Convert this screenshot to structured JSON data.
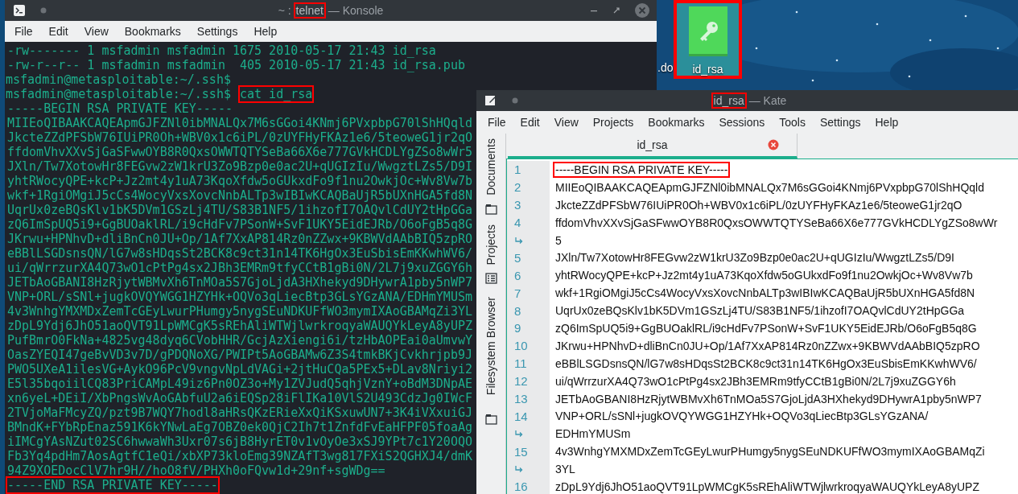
{
  "desktop": {
    "icons": [
      {
        "kind": "label-only",
        "label": ".do"
      },
      {
        "kind": "key-file",
        "label": "id_rsa",
        "selected": true,
        "highlighted": true
      }
    ]
  },
  "konsole": {
    "title": [
      {
        "text": "~ :",
        "highlighted": false
      },
      {
        "text": "telnet",
        "highlighted": true
      },
      {
        "text": "— Konsole",
        "highlighted": false
      }
    ],
    "menu": [
      "File",
      "Edit",
      "View",
      "Bookmarks",
      "Settings",
      "Help"
    ],
    "lines": [
      {
        "text": "-rw------- 1 msfadmin msfadmin 1675 2010-05-17 21:43 id_rsa",
        "highlighted": false
      },
      {
        "text": "-rw-r--r-- 1 msfadmin msfadmin  405 2010-05-17 21:43 id_rsa.pub",
        "highlighted": false
      },
      {
        "prompt": "msfadmin@metasploitable:~/.ssh$"
      },
      {
        "prompt": "msfadmin@metasploitable:~/.ssh$",
        "text": "cat id_rsa",
        "highlighted": true
      },
      {
        "text": "-----BEGIN RSA PRIVATE KEY-----",
        "highlighted": false
      },
      {
        "text": "MIIEoQIBAAKCAQEApmGJFZNl0ibMNALQx7M6sGGoi4KNmj6PVxpbpG70lShHQqld",
        "highlighted": false
      },
      {
        "text": "JkcteZZdPFSbW76IUiPR0Oh+WBV0x1c6iPL/0zUYFHyFKAz1e6/5teoweG1jr2qO",
        "highlighted": false
      },
      {
        "text": "ffdomVhvXXvSjGaSFwwOYB8R0QxsOWWTQTYSeBa66X6e777GVkHCDLYgZSo8wWr5",
        "highlighted": false
      },
      {
        "text": "JXln/Tw7XotowHr8FEGvw2zW1krU3Zo9Bzp0e0ac2U+qUGIzIu/WwgztLZs5/D9I",
        "highlighted": false
      },
      {
        "text": "yhtRWocyQPE+kcP+Jz2mt4y1uA73KqoXfdw5oGUkxdFo9f1nu2OwkjOc+Wv8Vw7b",
        "highlighted": false
      },
      {
        "text": "wkf+1RgiOMgiJ5cCs4WocyVxsXovcNnbALTp3wIBIwKCAQBaUjR5bUXnHGA5fd8N",
        "highlighted": false
      },
      {
        "text": "UqrUx0zeBQsKlv1bK5DVm1GSzLj4TU/S83B1NF5/1ihzofI7OAQvlCdUY2tHpGGa",
        "highlighted": false
      },
      {
        "text": "zQ6ImSpUQ5i9+GgBUOaklRL/i9cHdFv7PSonW+SvF1UKY5EidEJRb/O6oFgB5q8G",
        "highlighted": false
      },
      {
        "text": "JKrwu+HPNhvD+dliBnCn0JU+Op/1Af7XxAP814Rz0nZZwx+9KBWVdAAbBIQ5zpRO",
        "highlighted": false
      },
      {
        "text": "eBBlLSGDsnsQN/lG7w8sHDqsSt2BCK8c9ct31n14TK6HgOx3EuSbisEmKKwhWV6/",
        "highlighted": false
      },
      {
        "text": "ui/qWrrzurXA4Q73wO1cPtPg4sx2JBh3EMRm9tfyCCtB1gBi0N/2L7j9xuZGGY6h",
        "highlighted": false
      },
      {
        "text": "JETbAoGBANI8HzRjytWBMvXh6TnMOa5S7GjoLjdA3HXhekyd9DHywrA1pby5nWP7",
        "highlighted": false
      },
      {
        "text": "VNP+ORL/sSNl+jugkOVQYWGG1HZYHk+OQVo3qLiecBtp3GLsYGzANA/EDHmYMUSm",
        "highlighted": false
      },
      {
        "text": "4v3WnhgYMXMDxZemTcGEyLwurPHumgy5nygSEuNDKUFfWO3mymIXAoGBAMqZi3YL",
        "highlighted": false
      },
      {
        "text": "zDpL9Ydj6JhO51aoQVT91LpWMCgK5sREhAliWTWjlwrkroqyaWAUQYkLeyA8yUPZ",
        "highlighted": false
      },
      {
        "text": "PufBmrO0FkNa+4825vg48dyq6CVobHHR/GcjAzXiengi6i/tzHbAOPEai0aUmvwY",
        "highlighted": false
      },
      {
        "text": "OasZYEQI47geBvVD3v7D/gPDQNoXG/PWIPt5AoGBAMw6Z3S4tmkBKjCvkhrjpb9J",
        "highlighted": false
      },
      {
        "text": "PWO5UXeA1ilesVG+AykO96PcV9vngvNpLdVAGi+2jtHuCQa5PEx5+DLav8Nriyi2",
        "highlighted": false
      },
      {
        "text": "E5l35bqoiilCQ83PriCAMpL49iz6Pn0OZ3o+My1ZVJudQ5qhjVznY+oBdM3DNpAE",
        "highlighted": false
      },
      {
        "text": "xn6yeL+DEiI/XbPngsWvAoGAbfuU2a6iEQSp28iFlIKa10VlS2U493CdzJg0IWcF",
        "highlighted": false
      },
      {
        "text": "2TVjoMaFMcyZQ/pzt9B7WQY7hodl8aHRsQKzERieXxQiKSxuwUN7+3K4iVXxuiGJ",
        "highlighted": false
      },
      {
        "text": "BMndK+FYbRpEnaz591K6kYNwLaEg7OBZ0ek0QjC2Ih7t1ZnfdFvEaHFPF05foaAg",
        "highlighted": false
      },
      {
        "text": "iIMCgYAsNZut02SC6hwwaWh3Uxr07s6jB8HyrET0v1vOyOe3xSJ9YPt7c1Y20OQO",
        "highlighted": false
      },
      {
        "text": "Fb3Yq4pdHm7AosAgtfC1eQi/xbXP73kloEmg39NZAfT3wg817FXiS2QGHXJ4/dmK",
        "highlighted": false
      },
      {
        "text": "94Z9XOEDocClV7hr9H//hoO8fV/PHXh0oFQvw1d+29nf+sgWDg==",
        "highlighted": false
      },
      {
        "text": "-----END RSA PRIVATE KEY-----",
        "highlighted": true
      }
    ]
  },
  "kate": {
    "title": [
      {
        "text": "id_rsa",
        "highlighted": true
      },
      {
        "text": "— Kate",
        "highlighted": false
      }
    ],
    "menu": [
      "File",
      "Edit",
      "View",
      "Projects",
      "Bookmarks",
      "Sessions",
      "Tools",
      "Settings",
      "Help"
    ],
    "sidebar": [
      {
        "label": "Documents",
        "kind": "documents"
      },
      {
        "label": "Projects",
        "kind": "projects"
      },
      {
        "label": "Filesystem Browser",
        "kind": "filesystem"
      }
    ],
    "tabs": [
      {
        "label": "id_rsa",
        "selected": true
      }
    ],
    "lines": [
      {
        "number": "1",
        "text": "-----BEGIN RSA PRIVATE KEY-----",
        "highlighted": true
      },
      {
        "number": "2",
        "text": "MIIEoQIBAAKCAQEApmGJFZNl0ibMNALQx7M6sGGoi4KNmj6PVxpbpG70lShHQqld",
        "highlighted": false
      },
      {
        "number": "3",
        "text": "JkcteZZdPFSbW76IUiPR0Oh+WBV0x1c6iPL/0zUYFHyFKAz1e6/5teoweG1jr2qO",
        "highlighted": false
      },
      {
        "number": "4",
        "text": "ffdomVhvXXvSjGaSFwwOYB8R0QxsOWWTQTYSeBa66X6e777GVkHCDLYgZSo8wWr",
        "continuation": "5",
        "highlighted": false
      },
      {
        "number": "5",
        "text": "JXln/Tw7XotowHr8FEGvw2zW1krU3Zo9Bzp0e0ac2U+qUGIzIu/WwgztLZs5/D9I",
        "highlighted": false
      },
      {
        "number": "6",
        "text": "yhtRWocyQPE+kcP+Jz2mt4y1uA73KqoXfdw5oGUkxdFo9f1nu2OwkjOc+Wv8Vw7b",
        "highlighted": false
      },
      {
        "number": "7",
        "text": "wkf+1RgiOMgiJ5cCs4WocyVxsXovcNnbALTp3wIBIwKCAQBaUjR5bUXnHGA5fd8N",
        "highlighted": false
      },
      {
        "number": "8",
        "text": "UqrUx0zeBQsKlv1bK5DVm1GSzLj4TU/S83B1NF5/1ihzofI7OAQvlCdUY2tHpGGa",
        "highlighted": false
      },
      {
        "number": "9",
        "text": "zQ6ImSpUQ5i9+GgBUOaklRL/i9cHdFv7PSonW+SvF1UKY5EidEJRb/O6oFgB5q8G",
        "highlighted": false
      },
      {
        "number": "10",
        "text": "JKrwu+HPNhvD+dliBnCn0JU+Op/1Af7XxAP814Rz0nZZwx+9KBWVdAAbBIQ5zpRO",
        "highlighted": false
      },
      {
        "number": "11",
        "text": "eBBlLSGDsnsQN/lG7w8sHDqsSt2BCK8c9ct31n14TK6HgOx3EuSbisEmKKwhWV6/",
        "highlighted": false
      },
      {
        "number": "12",
        "text": "ui/qWrrzurXA4Q73wO1cPtPg4sx2JBh3EMRm9tfyCCtB1gBi0N/2L7j9xuZGGY6h",
        "highlighted": false
      },
      {
        "number": "13",
        "text": "JETbAoGBANI8HzRjytWBMvXh6TnMOa5S7GjoLjdA3HXhekyd9DHywrA1pby5nWP7",
        "highlighted": false
      },
      {
        "number": "14",
        "text": "VNP+ORL/sSNl+jugkOVQYWGG1HZYHk+OQVo3qLiecBtp3GLsYGzANA/",
        "continuation": "EDHmYMUSm",
        "highlighted": false
      },
      {
        "number": "15",
        "text": "4v3WnhgYMXMDxZemTcGEyLwurPHumgy5nygSEuNDKUFfWO3mymIXAoGBAMqZi",
        "continuation": "3YL",
        "highlighted": false
      },
      {
        "number": "16",
        "text": "zDpL9Ydj6JhO51aoQVT91LpWMCgK5sREhAliWTWjlwrkroqyaWAUQYkLeyA8yUPZ",
        "highlighted": false
      }
    ]
  }
}
